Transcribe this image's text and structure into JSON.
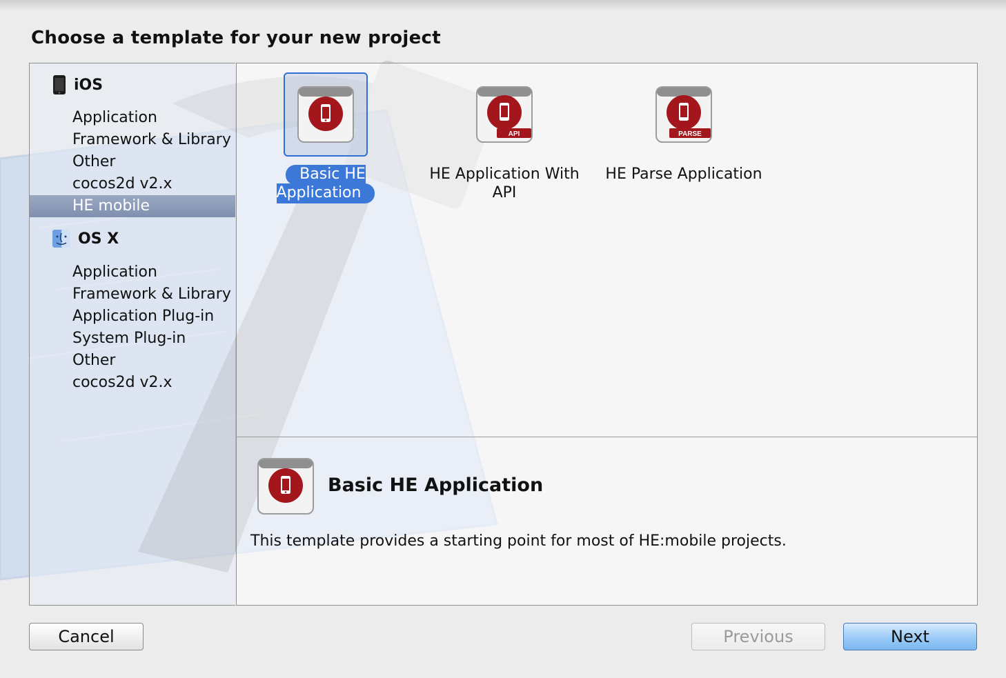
{
  "window": {
    "title": "Choose a template for your new project"
  },
  "sidebar": {
    "ios": {
      "label": "iOS",
      "items": [
        "Application",
        "Framework & Library",
        "Other",
        "cocos2d v2.x",
        "HE mobile"
      ],
      "selected_index": 4
    },
    "osx": {
      "label": "OS X",
      "items": [
        "Application",
        "Framework & Library",
        "Application Plug-in",
        "System Plug-in",
        "Other",
        "cocos2d v2.x"
      ]
    }
  },
  "templates": [
    {
      "label": "Basic HE Application",
      "badge": "",
      "selected": true
    },
    {
      "label": "HE Application With API",
      "badge": "API",
      "selected": false
    },
    {
      "label": "HE Parse Application",
      "badge": "PARSE",
      "selected": false
    }
  ],
  "description": {
    "title": "Basic HE Application",
    "text": "This template provides a starting point for most of HE:mobile projects."
  },
  "buttons": {
    "cancel": "Cancel",
    "previous": "Previous",
    "next": "Next"
  },
  "colors": {
    "selection_blue": "#3c78d8",
    "sidebar_selection": "#8b9bb8",
    "icon_red": "#a3161c"
  },
  "icons": [
    "iphone-icon",
    "finder-icon",
    "he-template-icon"
  ]
}
